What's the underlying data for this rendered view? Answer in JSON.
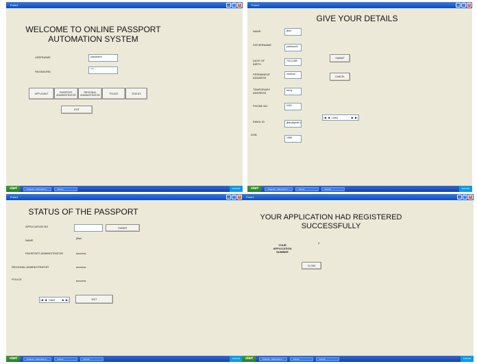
{
  "window": {
    "title": "Form1",
    "buttons": {
      "minimize": "_",
      "maximize": "□",
      "close": "X"
    }
  },
  "taskbar": {
    "start": "start",
    "task_project": "Project1 - Microsoft V...",
    "task_form1": "Form1",
    "task_form2": "Form2",
    "clock": "6:00 PM"
  },
  "login": {
    "title": "WELCOME TO ONLINE PASSPORT AUTOMATION SYSTEM",
    "username_label": "USERNAME",
    "username_value": "passadmin",
    "password_label": "PASSWORD",
    "password_value": "****",
    "buttons": {
      "applicant": "APPLICANT",
      "passport_admin": "PASSPORT ADMINISTRATOR",
      "regional_admin": "REGIONAL ADMINISTRATOR",
      "police": "POLICE",
      "status": "STATUS",
      "exit": "EXIT"
    }
  },
  "details": {
    "title": "GIVE YOUR DETAILS",
    "fields": [
      {
        "label": "NAME",
        "value": "jikas"
      },
      {
        "label": "FATHERNAME",
        "value": "pathasvelh"
      },
      {
        "label": "DATE OF BIRTH",
        "value": "7/01/1988"
      },
      {
        "label": "PERMANENT ADDRESS",
        "value": "madurai"
      },
      {
        "label": "TEMPORARY ADDRESS",
        "value": "trichy"
      },
      {
        "label": "PHONE NO",
        "value": "0452"
      },
      {
        "label": "EMAIL ID",
        "value": "jikas@gmail.c"
      },
      {
        "label": "DOB",
        "value": "1988"
      }
    ],
    "submit": "SUBMIT",
    "cancel": "CANCEL",
    "navigator": {
      "first": "|◀",
      "prev": "◀",
      "caption": "Data1",
      "next": "▶",
      "last": "▶|"
    }
  },
  "status": {
    "title": "STATUS OF THE PASSPORT",
    "appno_label": "APPLICATION NO",
    "appno_value": "",
    "submit": "SUBMIT",
    "rows": [
      {
        "label": "NAME",
        "value": "jikas"
      },
      {
        "label": "PASSPORT ADMINISTRATOR",
        "value": "success"
      },
      {
        "label": "REGIONAL ADMINISTRATOR",
        "value": "success"
      },
      {
        "label": "POLICE",
        "value": "success"
      }
    ],
    "navigator": {
      "first": "|◀",
      "prev": "◀",
      "caption": "Data1",
      "next": "▶",
      "last": "▶|"
    },
    "exit": "EXIT"
  },
  "registered": {
    "title": "YOUR APPLICATION HAD REGISTERED SUCCESSFULLY",
    "appno_label": "YOUR APPLICATION NUMBER",
    "appno_value": "4",
    "close": "CLOSE"
  }
}
